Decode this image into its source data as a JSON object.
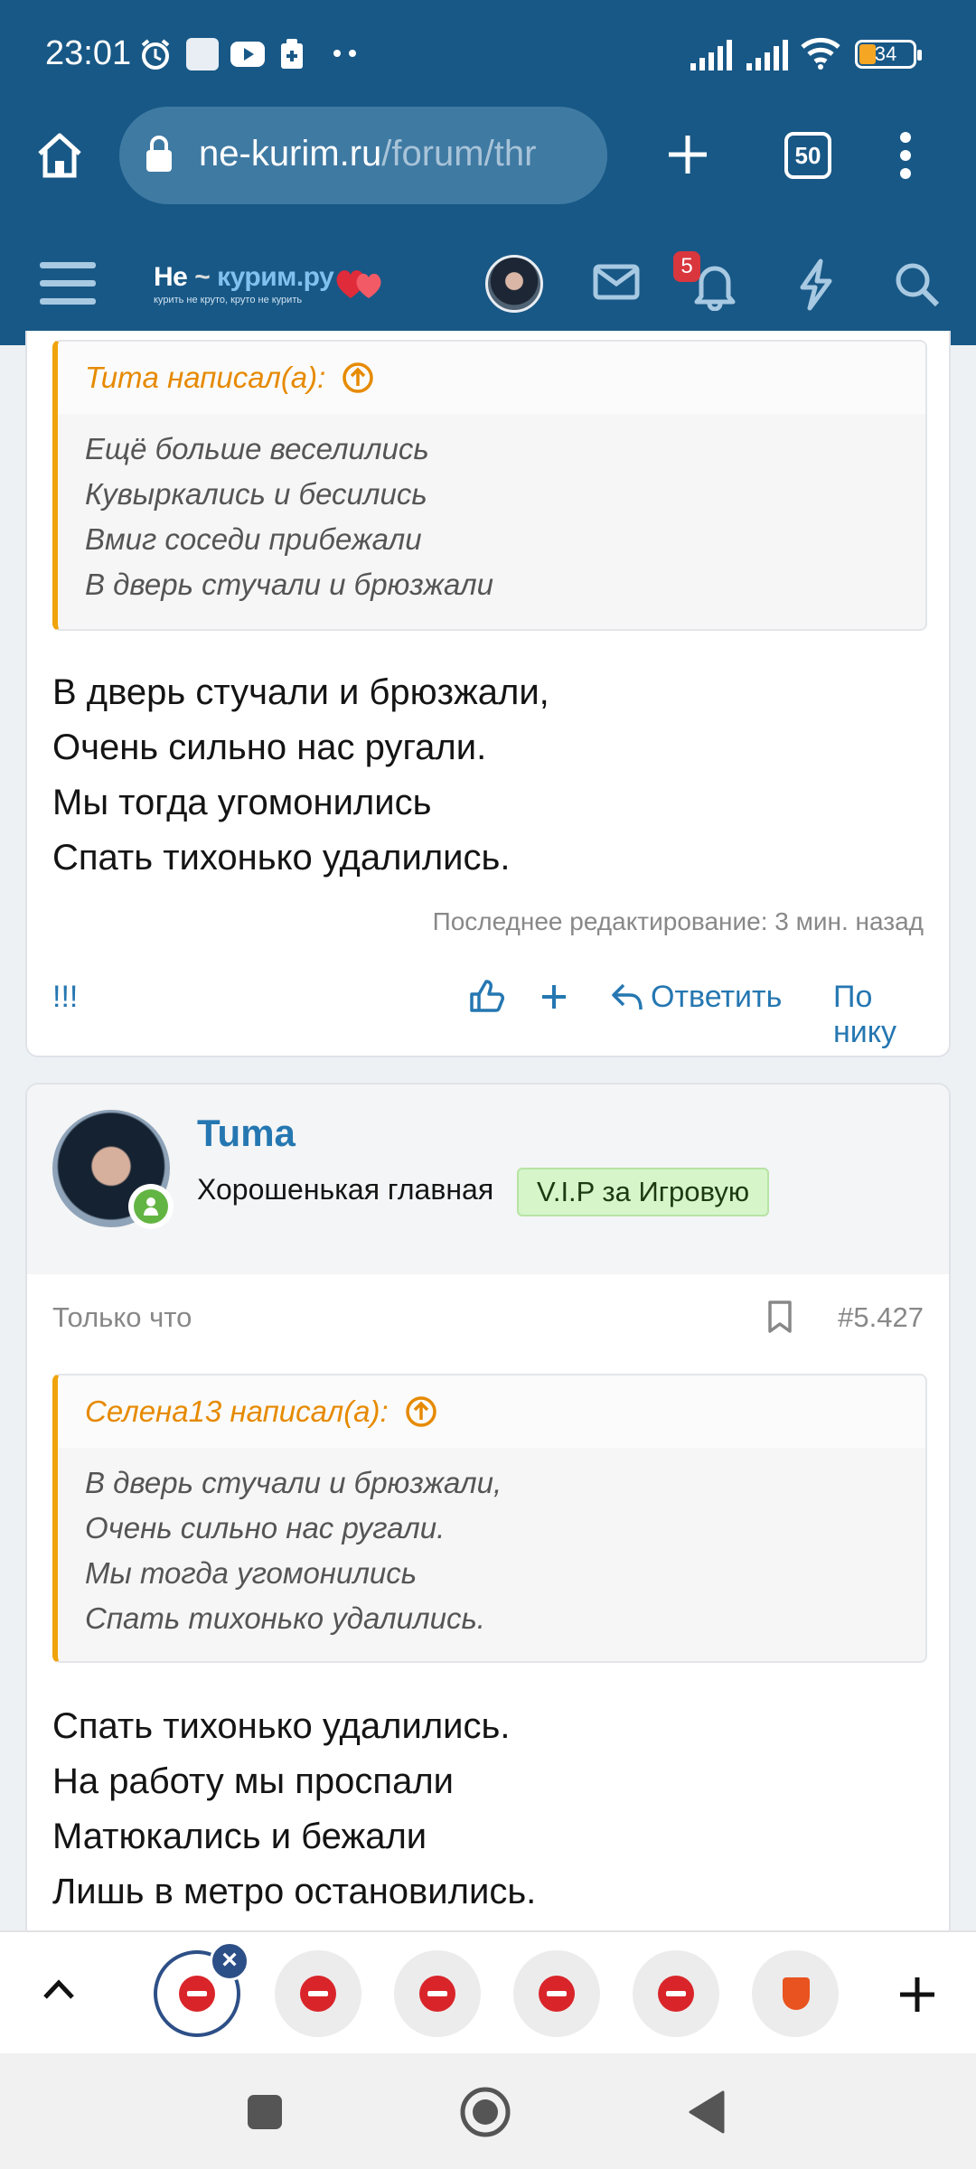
{
  "status_bar": {
    "time": "23:01",
    "battery": "34"
  },
  "browser": {
    "url_host": "ne-kurim.ru",
    "url_path": "/forum/thr",
    "tab_count": "50"
  },
  "site_header": {
    "logo_title_a": "Не",
    "logo_title_b": "курим.ру",
    "logo_tagline": "курить не круто, круто не курить",
    "notifications_count": "5"
  },
  "post1": {
    "quote_author": "Tuma написал(а):",
    "quote_lines": [
      "Ещё больше веселились",
      "Кувыркались и бесились",
      "Вмиг соседи прибежали",
      "В дверь стучали и брюзжали"
    ],
    "body_lines": [
      "В дверь стучали и брюзжали,",
      "Очень сильно нас ругали.",
      "Мы тогда угомонились",
      "Спать тихонько удалились."
    ],
    "last_edit": "Последнее редактирование: 3 мин. назад",
    "actions": {
      "report": "!!!",
      "reply": "Ответить",
      "by_nick": "По нику"
    }
  },
  "post2": {
    "author": "Tuma",
    "author_title": "Хорошенькая главная",
    "author_badge": "V.I.P за Игровую",
    "time": "Только что",
    "post_number": "#5.427",
    "quote_author": "Селена13 написал(а):",
    "quote_lines": [
      "В дверь стучали и брюзжали,",
      "Очень сильно нас ругали.",
      "Мы тогда угомонились",
      "Спать тихонько удалились."
    ],
    "body_lines": [
      "Спать тихонько удалились.",
      "На работу мы проспали",
      "Матюкались и бежали",
      "Лишь в метро остановились."
    ]
  },
  "colors": {
    "header_bg": "#185886",
    "link": "#2577b1",
    "quote_accent": "#f0a30a",
    "badge_red": "#d9363e",
    "vip_bg": "#d6f5c9"
  }
}
